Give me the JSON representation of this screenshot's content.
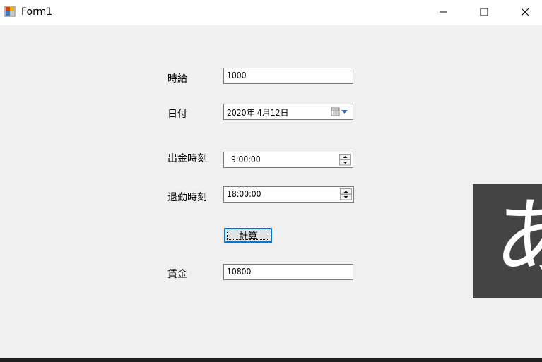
{
  "window": {
    "title": "Form1"
  },
  "titlebar": {
    "minimize_icon": "minimize-icon",
    "maximize_icon": "maximize-icon",
    "close_icon": "close-icon"
  },
  "form": {
    "wage_label": "時給",
    "wage_value": "1000",
    "date_label": "日付",
    "date_value": "2020年  4月12日",
    "clock_in_label": "出金時刻",
    "clock_in_value": "9:00:00",
    "clock_out_label": "退勤時刻",
    "clock_out_value": "18:00:00",
    "calc_button": "計算",
    "pay_label": "賃金",
    "pay_value": "10800"
  },
  "ime_indicator": {
    "char": "あ",
    "color": "#444444"
  },
  "colors": {
    "accent": "#0078d7",
    "background": "#f0f0f0"
  }
}
